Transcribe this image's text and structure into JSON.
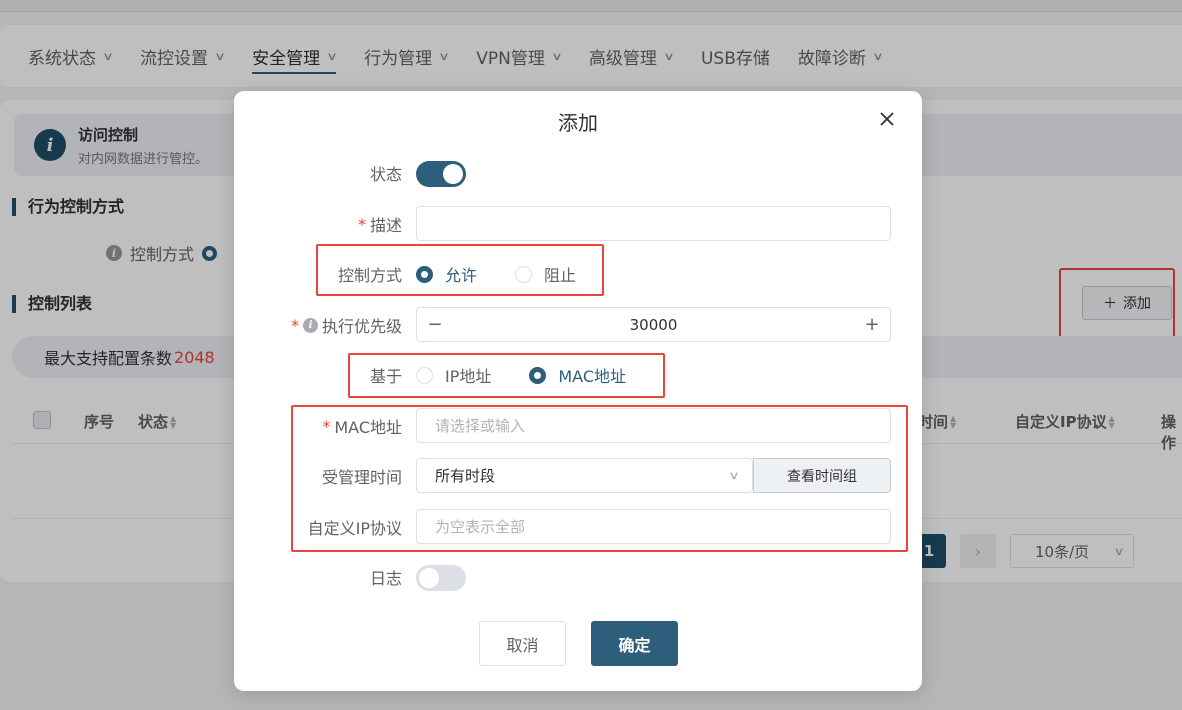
{
  "nav": {
    "items": [
      {
        "label": "系统状态",
        "active": false
      },
      {
        "label": "流控设置",
        "active": false
      },
      {
        "label": "安全管理",
        "active": true
      },
      {
        "label": "行为管理",
        "active": false
      },
      {
        "label": "VPN管理",
        "active": false
      },
      {
        "label": "高级管理",
        "active": false
      },
      {
        "label": "USB存储",
        "active": false
      },
      {
        "label": "故障诊断",
        "active": false
      }
    ]
  },
  "page": {
    "info_title": "访问控制",
    "info_desc": "对内网数据进行管控。",
    "section_mode": "行为控制方式",
    "control_mode_label": "控制方式",
    "section_list": "控制列表",
    "add_button": "添加",
    "max_label": "最大支持配置条数",
    "max_value": "2048",
    "columns": {
      "seq": "序号",
      "status": "状态",
      "time_partial": "时间",
      "custom_ip": "自定义IP协议",
      "ops_partial": "操作"
    },
    "pager": {
      "current_page": "1",
      "next": "›",
      "page_size": "10条/页"
    }
  },
  "dialog": {
    "title": "添加",
    "status_label": "状态",
    "status_on": true,
    "desc_label": "描述",
    "desc_value": "",
    "mode_label": "控制方式",
    "mode_options": [
      {
        "label": "允许",
        "checked": true
      },
      {
        "label": "阻止",
        "checked": false
      }
    ],
    "priority_label": "执行优先级",
    "priority_value": "30000",
    "based_label": "基于",
    "based_options": [
      {
        "label": "IP地址",
        "checked": false
      },
      {
        "label": "MAC地址",
        "checked": true
      }
    ],
    "mac_label": "MAC地址",
    "mac_placeholder": "请选择或输入",
    "time_label": "受管理时间",
    "time_value": "所有时段",
    "time_button": "查看时间组",
    "custom_ip_label": "自定义IP协议",
    "custom_ip_placeholder": "为空表示全部",
    "log_label": "日志",
    "log_on": false,
    "cancel_label": "取消",
    "ok_label": "确定"
  },
  "colors": {
    "accent": "#2d5f7d",
    "required": "#e8453c",
    "highlight_frame": "#e8453c"
  }
}
